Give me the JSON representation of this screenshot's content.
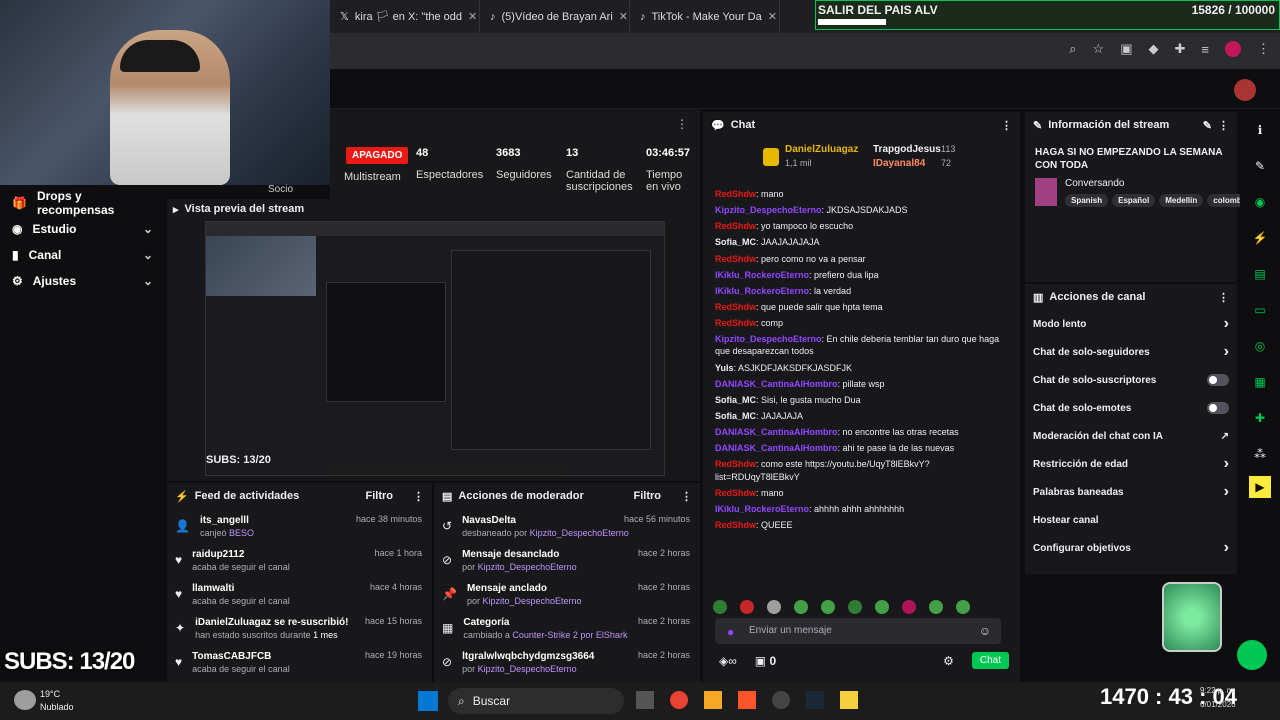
{
  "tabs": [
    {
      "label": "kira 🏳 en X: \"the odd"
    },
    {
      "label": "(5)Vídeo de Brayan Ari"
    },
    {
      "label": "TikTok - Make Your Da"
    }
  ],
  "overlay": {
    "title": "SALIR DEL PAIS ALV",
    "counter": "15826 / 100000",
    "subs": "SUBS: 13/20",
    "timer": "1470 : 43 : 04"
  },
  "stats": {
    "status": "APAGADO",
    "multistream_label": "Multistream",
    "viewers": "48",
    "viewers_label": "Espectadores",
    "followers": "3683",
    "followers_label": "Seguidores",
    "subs": "13",
    "subs_label": "Cantidad de suscripciones",
    "uptime": "03:46:57",
    "uptime_label": "Tiempo en vivo"
  },
  "nav": {
    "socio": "Socio",
    "items": [
      {
        "label": "Drops y recompensas"
      },
      {
        "label": "Estudio"
      },
      {
        "label": "Canal"
      },
      {
        "label": "Ajustes"
      }
    ]
  },
  "preview": {
    "title": "Vista previa del stream",
    "inner_subs": "SUBS: 13/20"
  },
  "feed": {
    "title": "Feed de actividades",
    "filter": "Filtro",
    "items": [
      {
        "name": "its_angelll",
        "sub": "canjeó",
        "sub2": "BESO",
        "time": "hace 38 minutos"
      },
      {
        "name": "raidup2112",
        "sub": "acaba de seguir el canal",
        "sub2": "",
        "time": "hace 1 hora"
      },
      {
        "name": "llamwalti",
        "sub": "acaba de seguir el canal",
        "sub2": "",
        "time": "hace 4 horas"
      },
      {
        "name": "iDanielZuluagaz se re-suscribió!",
        "sub": "han estado suscritos durante",
        "sub2": "1 mes",
        "time": "hace 15 horas"
      },
      {
        "name": "TomasCABJFCB",
        "sub": "acaba de seguir el canal",
        "sub2": "",
        "time": "hace 19 horas"
      }
    ]
  },
  "mod": {
    "title": "Acciones de moderador",
    "filter": "Filtro",
    "items": [
      {
        "name": "NavasDelta",
        "sub": "desbaneado por",
        "sub2": "Kipzito_DespechoEterno",
        "time": "hace 56 minutos"
      },
      {
        "name": "Mensaje desanclado",
        "sub": "por",
        "sub2": "Kipzito_DespechoEterno",
        "time": "hace 2 horas"
      },
      {
        "name": "Mensaje anclado",
        "sub": "por",
        "sub2": "Kipzito_DespechoEterno",
        "time": "hace 2 horas"
      },
      {
        "name": "Categoría",
        "sub": "cambiado a",
        "sub2": "Counter-Strike 2 por ElShark",
        "time": "hace 2 horas"
      },
      {
        "name": "ltgralwlwqbchydgmzsg3664",
        "sub": "por",
        "sub2": "Kipzito_DespechoEterno",
        "time": "hace 2 horas"
      }
    ]
  },
  "chat": {
    "title": "Chat",
    "top1": "DanielZuluagaz",
    "top1_count": "1,1 mil",
    "top2": "TrapgodJesus",
    "top2_count": "113",
    "top3": "IDayanal84",
    "top3_count": "72",
    "messages": [
      {
        "user": "RedShdw",
        "text": "mano",
        "color": "#e91916"
      },
      {
        "user": "Kipzito_DespechoEterno",
        "text": "JKDSAJSDAKJADS",
        "color": "#9147ff"
      },
      {
        "user": "RedShdw",
        "text": "yo tampoco lo escucho",
        "color": "#e91916"
      },
      {
        "user": "Sofia_MC",
        "text": "JAAJAJAJAJA",
        "color": "#efeff1"
      },
      {
        "user": "RedShdw",
        "text": "pero como no va a pensar",
        "color": "#e91916"
      },
      {
        "user": "IKiklu_RockeroEterno",
        "text": "prefiero dua lipa",
        "color": "#9147ff"
      },
      {
        "user": "IKiklu_RockeroEterno",
        "text": "la verdad",
        "color": "#9147ff"
      },
      {
        "user": "RedShdw",
        "text": "que puede salir que hpta tema",
        "color": "#e91916"
      },
      {
        "user": "RedShdw",
        "text": "comp",
        "color": "#e91916"
      },
      {
        "user": "Kipzito_DespechoEterno",
        "text": "En chile deberia temblar tan duro que haga que desaparezcan todos",
        "color": "#9147ff"
      },
      {
        "user": "Yuls",
        "text": "ASJKDFJAKSDFKJASDFJK",
        "color": "#efeff1"
      },
      {
        "user": "DANIASK_CantinaAlHombro",
        "text": "pillate wsp",
        "color": "#9147ff"
      },
      {
        "user": "Sofia_MC",
        "text": "Sisi, le gusta mucho Dua",
        "color": "#efeff1"
      },
      {
        "user": "Sofia_MC",
        "text": "JAJAJAJA",
        "color": "#efeff1"
      },
      {
        "user": "DANIASK_CantinaAlHombro",
        "text": "no encontre las otras recetas",
        "color": "#9147ff"
      },
      {
        "user": "DANIASK_CantinaAlHombro",
        "text": "ahi te pase la de las nuevas",
        "color": "#9147ff"
      },
      {
        "user": "RedShdw",
        "text": "como este https://youtu.be/UqyT8lEBkvY?list=RDUqyT8lEBkvY",
        "color": "#e91916"
      },
      {
        "user": "RedShdw",
        "text": "mano",
        "color": "#e91916"
      },
      {
        "user": "IKiklu_RockeroEterno",
        "text": "ahhhh ahhh ahhhhhhh",
        "color": "#9147ff"
      },
      {
        "user": "RedShdw",
        "text": "QUEEE",
        "color": "#e91916"
      }
    ],
    "input_placeholder": "Enviar un mensaje",
    "points": "0",
    "send": "Chat"
  },
  "info": {
    "title": "Información del stream",
    "stream_title": "HAGA SI NO EMPEZANDO LA SEMANA CON TODA",
    "category": "Conversando",
    "tags": [
      "Spanish",
      "Español",
      "Medellín",
      "colombi"
    ]
  },
  "actions": {
    "title": "Acciones de canal",
    "items": [
      {
        "label": "Modo lento",
        "kind": "chev"
      },
      {
        "label": "Chat de solo-seguidores",
        "kind": "chev"
      },
      {
        "label": "Chat de solo-suscriptores",
        "kind": "toggle"
      },
      {
        "label": "Chat de solo-emotes",
        "kind": "toggle"
      },
      {
        "label": "Moderación del chat con IA",
        "kind": "ext"
      },
      {
        "label": "Restricción de edad",
        "kind": "chev"
      },
      {
        "label": "Palabras baneadas",
        "kind": "chev"
      },
      {
        "label": "Hostear canal",
        "kind": "none"
      },
      {
        "label": "Configurar objetivos",
        "kind": "chev"
      }
    ]
  },
  "taskbar": {
    "temp": "19°C",
    "weather": "Nublado",
    "search": "Buscar",
    "time": "9:22 p. m.",
    "date": "6/01/2026"
  },
  "colors": {
    "accent": "#9147ff",
    "twitch_green": "#00c853",
    "live_red": "#e91916"
  }
}
